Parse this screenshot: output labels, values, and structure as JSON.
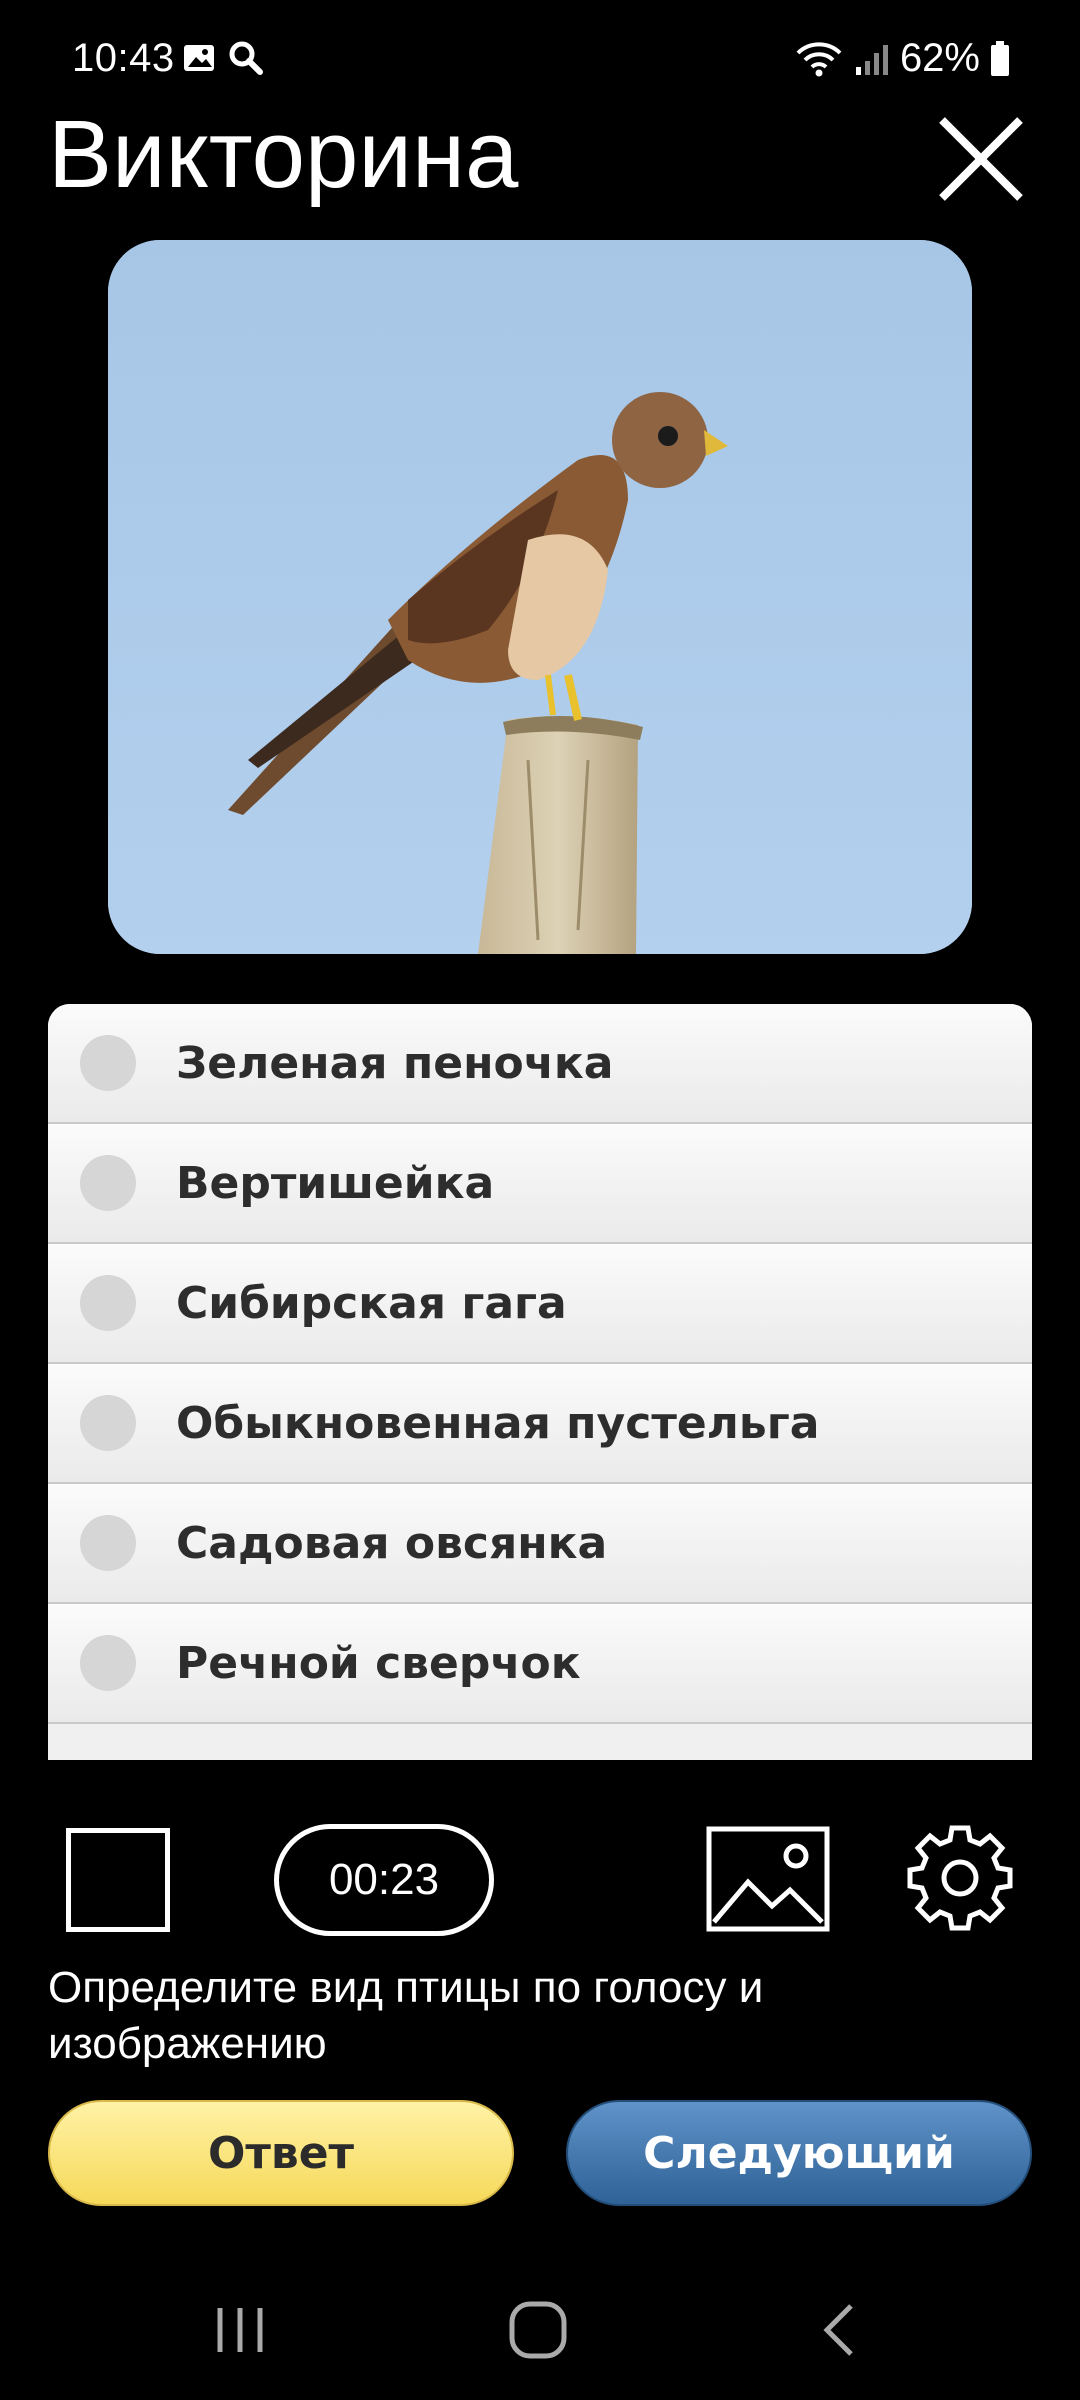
{
  "status_bar": {
    "time": "10:43",
    "battery": "62%",
    "icons": [
      "image-notification-icon",
      "search-icon",
      "wifi-icon",
      "signal-icon",
      "battery-icon"
    ]
  },
  "header": {
    "title": "Викторина",
    "close_icon": "close-icon"
  },
  "photo": {
    "subject_icon": "bird-photo"
  },
  "options": [
    {
      "label": "Зеленая пеночка"
    },
    {
      "label": "Вертишейка"
    },
    {
      "label": "Сибирская гага"
    },
    {
      "label": "Обыкновенная пустельга"
    },
    {
      "label": "Садовая овсянка"
    },
    {
      "label": "Речной сверчок"
    }
  ],
  "controls": {
    "timer": "00:23",
    "stop_icon": "stop-icon",
    "image_icon": "image-icon",
    "settings_icon": "gear-icon"
  },
  "instruction": "Определите вид птицы по голосу и изображению",
  "buttons": {
    "answer": "Ответ",
    "next": "Следующий"
  },
  "colors": {
    "answer_button": "#f6d95a",
    "next_button": "#2f6397",
    "background": "#000000",
    "sky": "#a9c8e8"
  }
}
